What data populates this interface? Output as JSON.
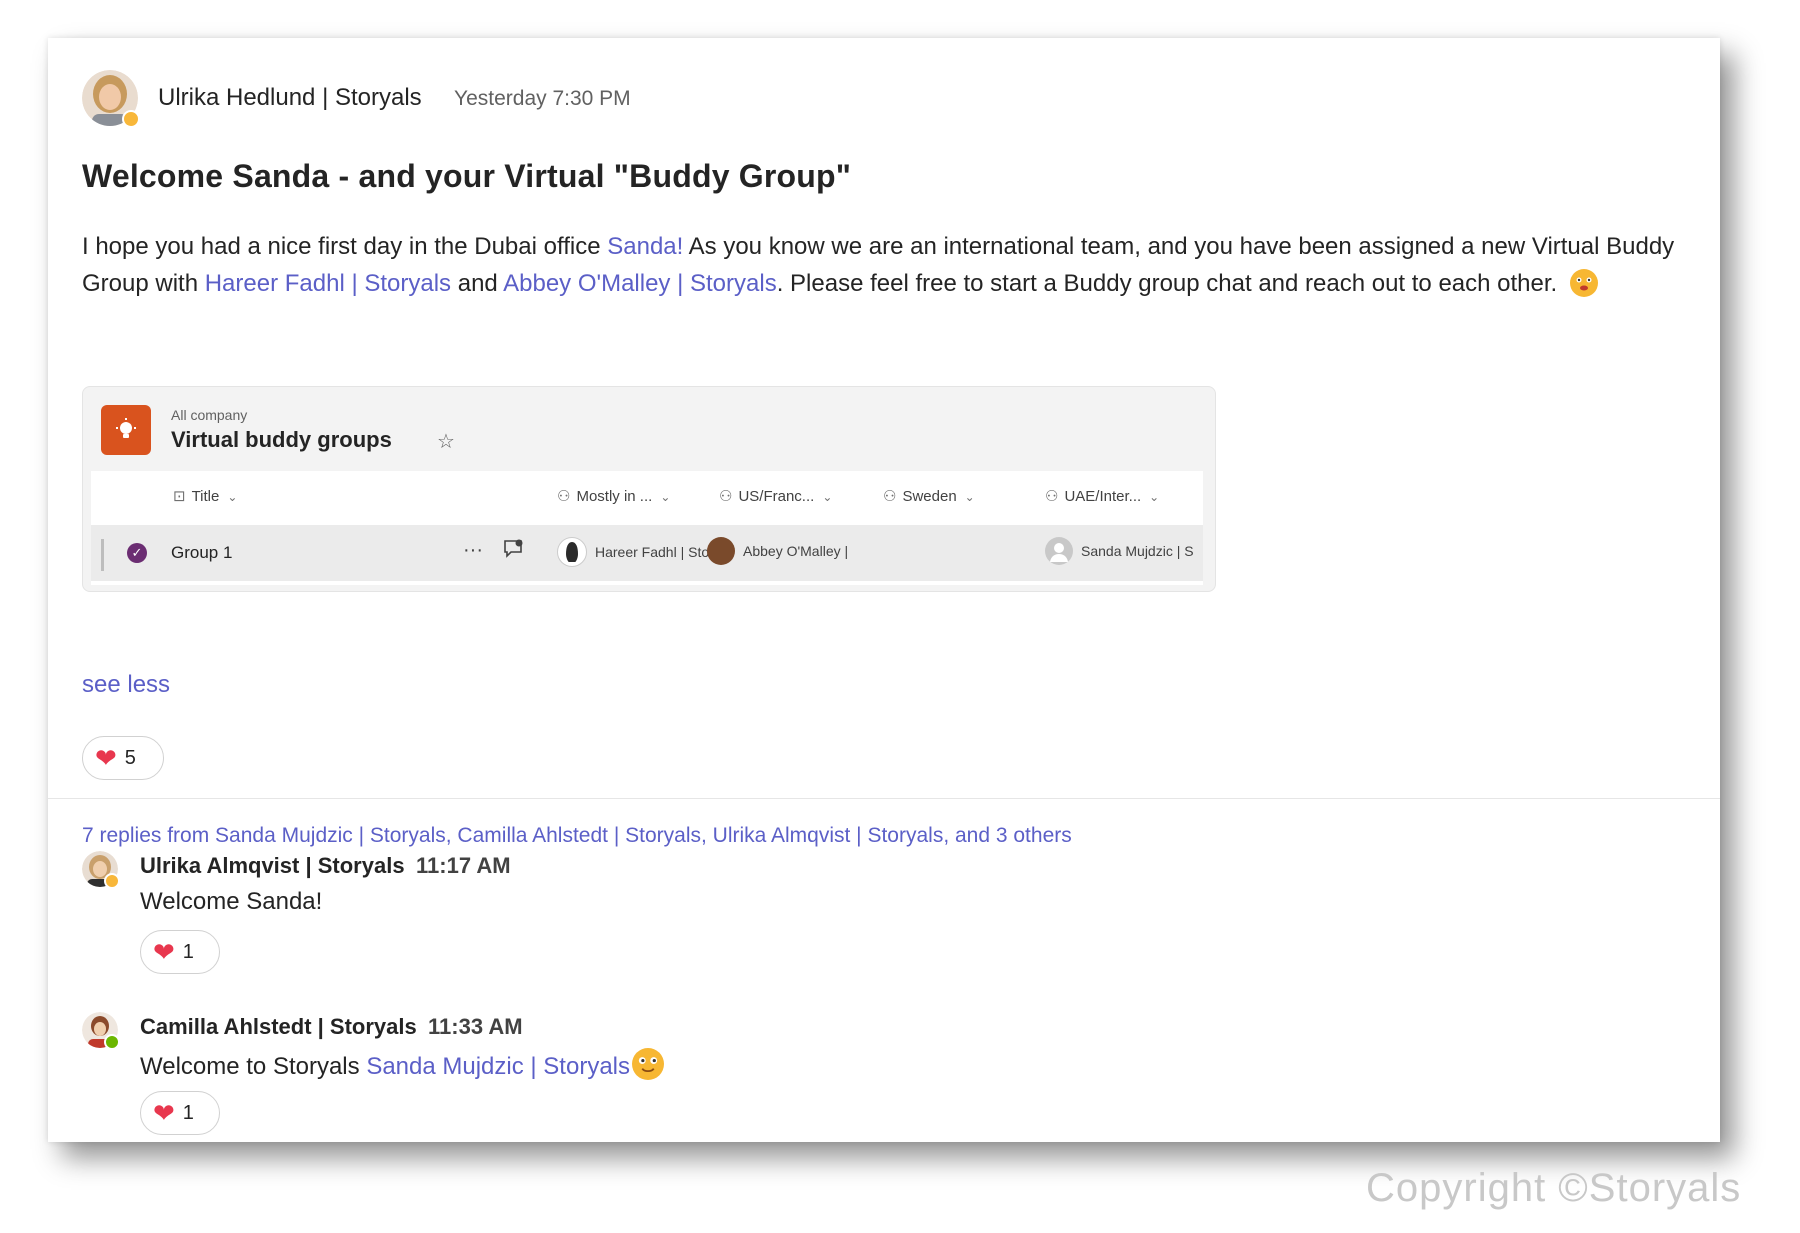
{
  "post": {
    "author": "Ulrika Hedlund | Storyals",
    "timestamp": "Yesterday 7:30 PM",
    "title": "Welcome Sanda - and your Virtual \"Buddy Group\"",
    "body_1": "I hope you had a nice first day in the Dubai office ",
    "mention_1": "Sanda!",
    "body_2": " As you know we are an international team, and you have been assigned a new Virtual Buddy Group with ",
    "mention_2": "Hareer Fadhl | Storyals",
    "body_3": " and ",
    "mention_3": "Abbey O'Malley | Storyals",
    "body_4": ". Please feel free to start a Buddy group chat and reach out to each other.",
    "author_presence": "away",
    "see_less": "see less",
    "reaction": {
      "icon": "heart-icon",
      "count": "5"
    }
  },
  "list_card": {
    "scope": "All company",
    "name": "Virtual buddy groups",
    "star_icon": "star-icon",
    "columns": [
      "Title",
      "Mostly in ...",
      "US/Franc...",
      "Sweden",
      "UAE/Inter..."
    ],
    "row": {
      "title": "Group 1",
      "more": "···",
      "mostly_in": "Hareer Fadhl | Sto",
      "us_france": "Abbey O'Malley |",
      "uae": "Sanda Mujdzic | S"
    }
  },
  "replies_summary": "7 replies from Sanda Mujdzic | Storyals, Camilla Ahlstedt | Storyals, Ulrika Almqvist | Storyals, and 3 others",
  "replies": [
    {
      "author": "Ulrika Almqvist | Storyals",
      "time": "11:17 AM",
      "text": "Welcome Sanda!",
      "presence": "away",
      "reaction": {
        "icon": "heart-icon",
        "count": "1"
      }
    },
    {
      "author": "Camilla Ahlstedt | Storyals",
      "time": "11:33 AM",
      "text": "Welcome to Storyals ",
      "mention": "Sanda Mujdzic | Storyals",
      "presence": "available",
      "reaction": {
        "icon": "heart-icon",
        "count": "1"
      }
    }
  ],
  "colors": {
    "accent": "#5b5fc7",
    "presence_away": "#f8b73a",
    "presence_available": "#6bb700",
    "heart": "#e8374e",
    "list_icon": "#d9531e"
  },
  "watermark": "Copyright ©Storyals"
}
